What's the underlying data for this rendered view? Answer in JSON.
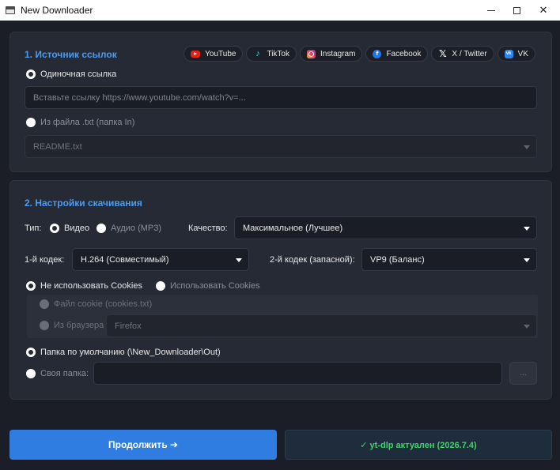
{
  "window": {
    "title": "New Downloader",
    "controls": {
      "minimize": "—",
      "maximize": "☐",
      "close": "✕"
    }
  },
  "source": {
    "title": "1. Источник ссылок",
    "platforms": [
      {
        "label": "YouTube",
        "icon": "youtube-icon",
        "color": "#e62117"
      },
      {
        "label": "TikTok",
        "icon": "tiktok-icon",
        "color": "#2de2e6"
      },
      {
        "label": "Instagram",
        "icon": "instagram-icon",
        "color": "#e4405f"
      },
      {
        "label": "Facebook",
        "icon": "facebook-icon",
        "color": "#1877f2"
      },
      {
        "label": "X / Twitter",
        "icon": "x-icon",
        "color": "#ffffff"
      },
      {
        "label": "VK",
        "icon": "vk-icon",
        "color": "#2787f5"
      }
    ],
    "single_link_label": "Одиночная ссылка",
    "url_placeholder": "Вставьте ссылку https://www.youtube.com/watch?v=...",
    "from_file_label": "Из файла .txt (папка In)",
    "file_value": "README.txt"
  },
  "settings": {
    "title": "2. Настройки скачивания",
    "type_label": "Тип:",
    "type_video": "Видео",
    "type_audio": "Аудио (MP3)",
    "quality_label": "Качество:",
    "quality_value": "Максимальное (Лучшее)",
    "codec1_label": "1-й кодек:",
    "codec1_value": "H.264 (Совместимый)",
    "codec2_label": "2-й кодек (запасной):",
    "codec2_value": "VP9 (Баланс)",
    "no_cookies_label": "Не использовать Cookies",
    "use_cookies_label": "Использовать Cookies",
    "cookie_file_label": "Файл cookie (cookies.txt)",
    "from_browser_label": "Из браузера",
    "browser_value": "Firefox",
    "default_folder_label": "Папка по умолчанию (\\New_Downloader\\Out)",
    "custom_folder_label": "Своя папка:",
    "custom_folder_value": "",
    "browse_label": "..."
  },
  "actions": {
    "continue_label": "Продолжить ➔",
    "update_status": "✓ yt-dlp актуален (2026.7.4)"
  },
  "colors": {
    "accent": "#2f7de1",
    "section_title": "#4a9cf3",
    "success": "#3fd36a",
    "background": "#1b1e27",
    "panel": "#262a35"
  }
}
